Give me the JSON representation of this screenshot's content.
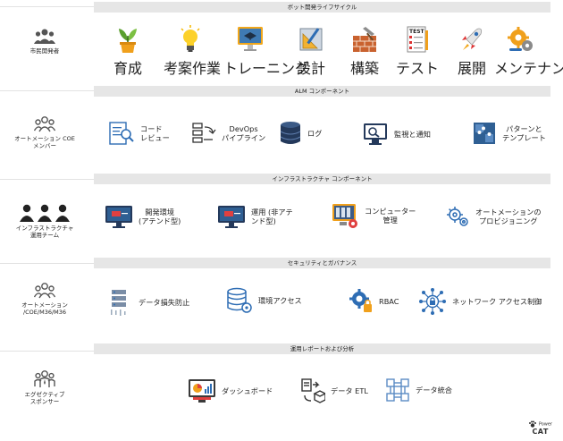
{
  "sections": {
    "lifecycle": {
      "title": "ボット開発ライフサイクル",
      "persona": "市民開発者",
      "items": [
        "育成",
        "考案作業",
        "トレーニング",
        "設計",
        "構築",
        "テスト",
        "展開",
        "メンテナンス"
      ]
    },
    "alm": {
      "title": "ALM コンポーネント",
      "persona": "オートメーション COE\nメンバー",
      "items": [
        "コード\nレビュー",
        "DevOps\nパイプライン",
        "ログ",
        "監視と通知",
        "パターンと\nテンプレート"
      ]
    },
    "infra": {
      "title": "インフラストラクチャ コンポーネント",
      "persona": "インフラストラクチャ\n運用チーム",
      "items": [
        "開発環境\n(アテンド型)",
        "運用 (非アテ\nンド型)",
        "コンピューター\n管理",
        "オートメーションの\nプロビジョニング"
      ]
    },
    "security": {
      "title": "セキュリティとガバナンス",
      "persona": "オートメーション\n/COE/M36/M36",
      "items": [
        "データ損失防止",
        "環境アクセス",
        "RBAC",
        "ネットワーク アクセス制御"
      ]
    },
    "reporting": {
      "title": "運用レポートおよび分析",
      "persona": "エグゼクティブ\nスポンサー",
      "items": [
        "ダッシュボード",
        "データ ETL",
        "データ統合"
      ]
    }
  },
  "logo": {
    "top": "Power",
    "bottom": "CAT"
  }
}
